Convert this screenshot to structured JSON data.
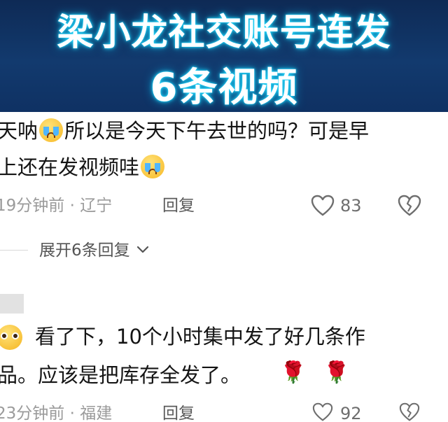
{
  "banner": {
    "line1": "梁小龙社交账号连发",
    "line2": "6条视频"
  },
  "comment1": {
    "line1_a": "天呐",
    "line1_b": "所以是今天下午去世的吗？可是早",
    "line2": "上还在发视频哇",
    "meta_time_location": "19分钟前 · 辽宁",
    "reply_label": "回复",
    "like_count": "83"
  },
  "expand_replies": {
    "label": "展开6条回复"
  },
  "comment2": {
    "line1": "看了下，10个小时集中发了好几条作",
    "line2": "品。应该是把库存全发了。",
    "rose_1": "🌹",
    "rose_2": "🌹",
    "meta_time_location": "23分钟前 · 福建",
    "reply_label": "回复",
    "like_count": "92"
  },
  "icons": {
    "like": "heart-outline-icon",
    "dislike": "broken-heart-icon",
    "expand": "chevron-down-icon",
    "emoji_cry": "crying-face-emoji",
    "emoji_plead": "pleading-face-emoji"
  },
  "colors": {
    "banner_bg": "#0e2a55",
    "banner_glow": "#2fe0ff",
    "text": "#141414",
    "meta": "#9b9b9b"
  }
}
